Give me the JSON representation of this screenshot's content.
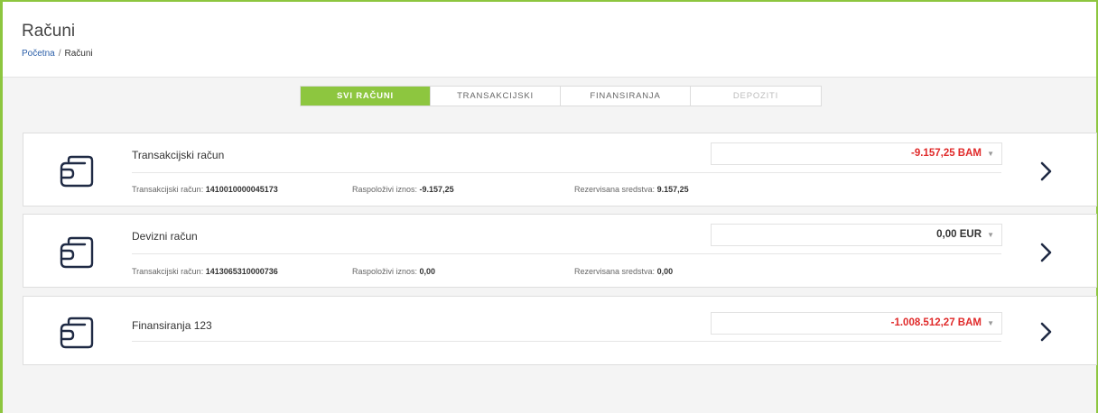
{
  "header": {
    "title": "Računi",
    "breadcrumb": {
      "home": "Početna",
      "separator": "/",
      "current": "Računi"
    }
  },
  "tabs": [
    {
      "label": "SVI RAČUNI",
      "state": "active"
    },
    {
      "label": "TRANSAKCIJSKI",
      "state": "normal"
    },
    {
      "label": "FINANSIRANJA",
      "state": "normal"
    },
    {
      "label": "DEPOZITI",
      "state": "disabled"
    }
  ],
  "accounts": [
    {
      "name": "Transakcijski račun",
      "amount": "-9.157,25 BAM",
      "amount_sign": "negative",
      "details": {
        "account_label": "Transakcijski račun:",
        "account_value": "1410010000045173",
        "available_label": "Raspoloživi iznos:",
        "available_value": "-9.157,25",
        "reserved_label": "Rezervisana sredstva:",
        "reserved_value": "9.157,25"
      }
    },
    {
      "name": "Devizni račun",
      "amount": "0,00 EUR",
      "amount_sign": "positive",
      "details": {
        "account_label": "Transakcijski račun:",
        "account_value": "1413065310000736",
        "available_label": "Raspoloživi iznos:",
        "available_value": "0,00",
        "reserved_label": "Rezervisana sredstva:",
        "reserved_value": "0,00"
      }
    },
    {
      "name": "Finansiranja 123",
      "amount": "-1.008.512,27 BAM",
      "amount_sign": "negative"
    }
  ],
  "icons": {
    "account": "wallet-icon",
    "open": "chevron-right-icon",
    "dropdown": "caret-down-icon"
  },
  "colors": {
    "accent": "#8dc63f",
    "negative": "#e02a2a",
    "link": "#2a5ea8"
  }
}
